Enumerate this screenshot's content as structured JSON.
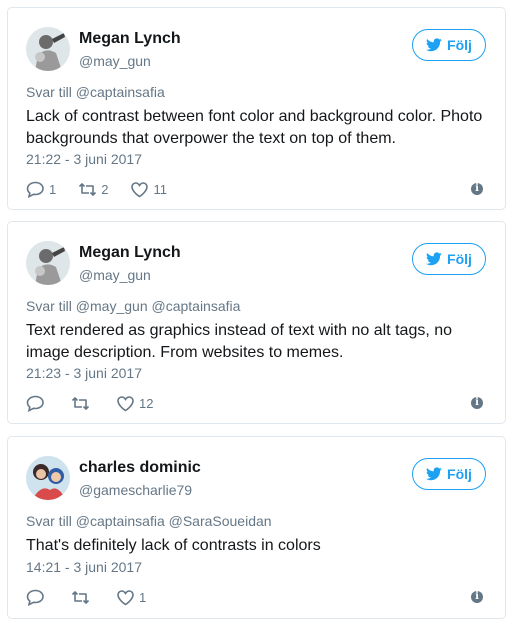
{
  "tweets": [
    {
      "name": "Megan Lynch",
      "handle": "@may_gun",
      "follow_label": "Följ",
      "reply_prefix": "Svar till",
      "reply_mentions": "@captainsafia",
      "text": "Lack of contrast between font color and background color. Photo backgrounds that overpower the text on top of them.",
      "timestamp": "21:22 - 3 juni 2017",
      "reply_count": "1",
      "retweet_count": "2",
      "like_count": "11"
    },
    {
      "name": "Megan Lynch",
      "handle": "@may_gun",
      "follow_label": "Följ",
      "reply_prefix": "Svar till",
      "reply_mentions": "@may_gun @captainsafia",
      "text": "Text rendered as graphics instead of text with no alt tags, no image description. From websites to memes.",
      "timestamp": "21:23 - 3 juni 2017",
      "reply_count": "",
      "retweet_count": "",
      "like_count": "12"
    },
    {
      "name": "charles dominic",
      "handle": "@gamescharlie79",
      "follow_label": "Följ",
      "reply_prefix": "Svar till",
      "reply_mentions": "@captainsafia @SaraSoueidan",
      "text": "That's definitely lack of contrasts in colors",
      "timestamp": "14:21 - 3 juni 2017",
      "reply_count": "",
      "retweet_count": "",
      "like_count": "1"
    }
  ],
  "colors": {
    "accent": "#1da1f2",
    "muted": "#657786",
    "text": "#14171a",
    "border": "#e1e8ed"
  },
  "icons": {
    "reply": "reply-icon",
    "retweet": "retweet-icon",
    "like": "heart-icon",
    "info": "info-icon",
    "follow": "twitter-bird-icon"
  }
}
